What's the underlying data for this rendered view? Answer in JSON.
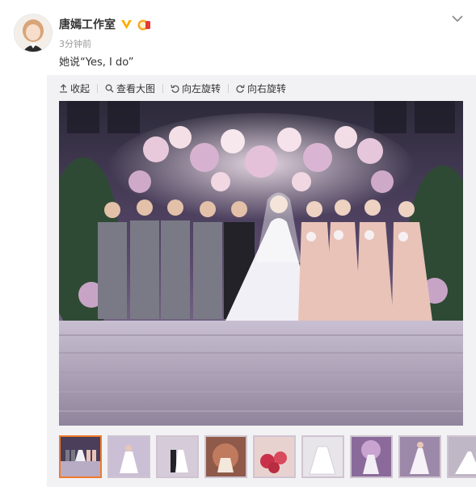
{
  "post": {
    "username": "唐嫣工作室",
    "time": "3分钟前",
    "text": "她说“Yes, I do”"
  },
  "toolbar": {
    "collapse_label": "收起",
    "view_large_label": "查看大图",
    "rotate_left_label": "向左旋转",
    "rotate_right_label": "向右旋转"
  },
  "thumbnails": {
    "count": 9,
    "active_index": 0
  },
  "colors": {
    "verified": "#ffab00",
    "active_thumb_border": "#f07a2a"
  },
  "icons": [
    "avatar",
    "verified-icon",
    "vip-badge-icon",
    "chevron-down-icon",
    "collapse-arrow-icon",
    "magnifier-icon",
    "rotate-left-icon",
    "rotate-right-icon"
  ]
}
